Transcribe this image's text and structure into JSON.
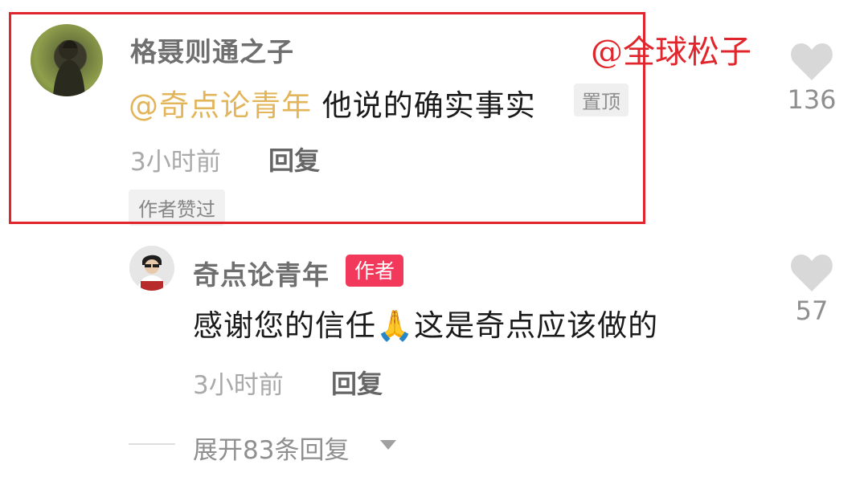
{
  "watermark": "@全球松子",
  "comments": [
    {
      "username": "格聂则通之子",
      "mention": "@奇点论青年",
      "text": " 他说的确实事实",
      "pinned_tag": "置顶",
      "time": "3小时前",
      "reply_label": "回复",
      "liked_tag": "作者赞过",
      "likes": "136"
    }
  ],
  "reply": {
    "username": "奇点论青年",
    "author_tag": "作者",
    "text_before": "感谢您的信任",
    "emoji": "🙏",
    "text_after": "这是奇点应该做的",
    "time": "3小时前",
    "reply_label": "回复",
    "likes": "57"
  },
  "expand": {
    "label": "展开83条回复"
  },
  "colors": {
    "highlight": "#e1252c",
    "mention": "#e3b55a",
    "author_tag": "#f2385b",
    "heart": "#d8d8d8"
  },
  "icons": [
    "heart-icon",
    "chevron-down-icon"
  ]
}
